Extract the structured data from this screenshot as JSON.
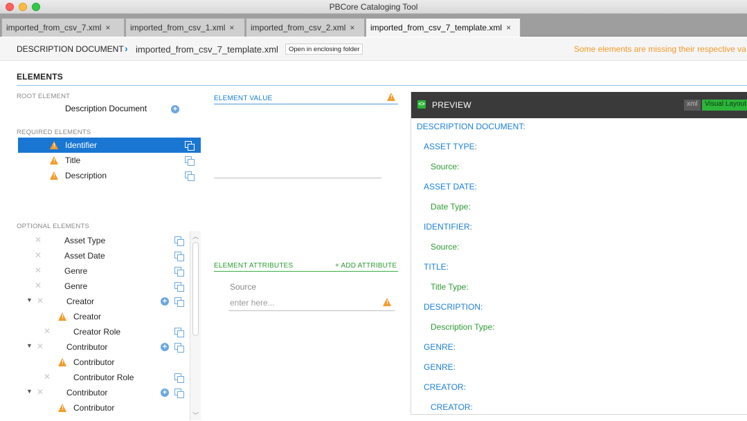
{
  "window": {
    "title": "PBCore Cataloging Tool"
  },
  "tabs": [
    {
      "label": "imported_from_csv_7.xml",
      "close": "×"
    },
    {
      "label": "imported_from_csv_1.xml",
      "close": "×"
    },
    {
      "label": "imported_from_csv_2.xml",
      "close": "×"
    },
    {
      "label": "imported_from_csv_7_template.xml",
      "close": "×",
      "active": true
    }
  ],
  "breadcrumb": {
    "root": "DESCRIPTION DOCUMENT",
    "separator": "›",
    "file": "imported_from_csv_7_template.xml",
    "open_folder": "Open in enclosing folder",
    "warning": "Some elements are missing their respective va"
  },
  "elements": {
    "title": "ELEMENTS",
    "root_label": "ROOT ELEMENT",
    "root_name": "Description Document",
    "required_label": "REQUIRED ELEMENTS",
    "required": [
      {
        "label": "Identifier",
        "selected": true
      },
      {
        "label": "Title"
      },
      {
        "label": "Description"
      }
    ],
    "optional_label": "OPTIONAL ELEMENTS",
    "optional": [
      {
        "label": "Asset Type"
      },
      {
        "label": "Asset Date"
      },
      {
        "label": "Genre"
      },
      {
        "label": "Genre"
      },
      {
        "label": "Creator"
      },
      {
        "label": "Creator"
      },
      {
        "label": "Creator Role"
      },
      {
        "label": "Contributor"
      },
      {
        "label": "Contributor"
      },
      {
        "label": "Contributor Role"
      },
      {
        "label": "Contributor"
      },
      {
        "label": "Contributor"
      }
    ]
  },
  "element_value": {
    "title": "ELEMENT VALUE"
  },
  "element_attributes": {
    "title": "ELEMENT ATTRIBUTES",
    "add": "+ ADD ATTRIBUTE",
    "attr_label": "Source",
    "attr_placeholder": "enter here..."
  },
  "preview": {
    "title": "PREVIEW",
    "xml_toggle": "xml",
    "visual_toggle": "Visual Layout",
    "lines": [
      {
        "text": "DESCRIPTION DOCUMENT:"
      },
      {
        "text": "ASSET TYPE:"
      },
      {
        "text": "Source:"
      },
      {
        "text": "ASSET DATE:"
      },
      {
        "text": "Date Type:"
      },
      {
        "text": "IDENTIFIER:"
      },
      {
        "text": "Source:"
      },
      {
        "text": "TITLE:"
      },
      {
        "text": "Title Type:"
      },
      {
        "text": "DESCRIPTION:"
      },
      {
        "text": "Description Type:"
      },
      {
        "text": "GENRE:"
      },
      {
        "text": "GENRE:"
      },
      {
        "text": "CREATOR:"
      },
      {
        "text": "CREATOR:"
      }
    ]
  },
  "colors": {
    "accent": "#1976d2",
    "warning": "#f39a2a",
    "preview_key": "#1a7fd6",
    "preview_attr": "#2b9b33"
  }
}
